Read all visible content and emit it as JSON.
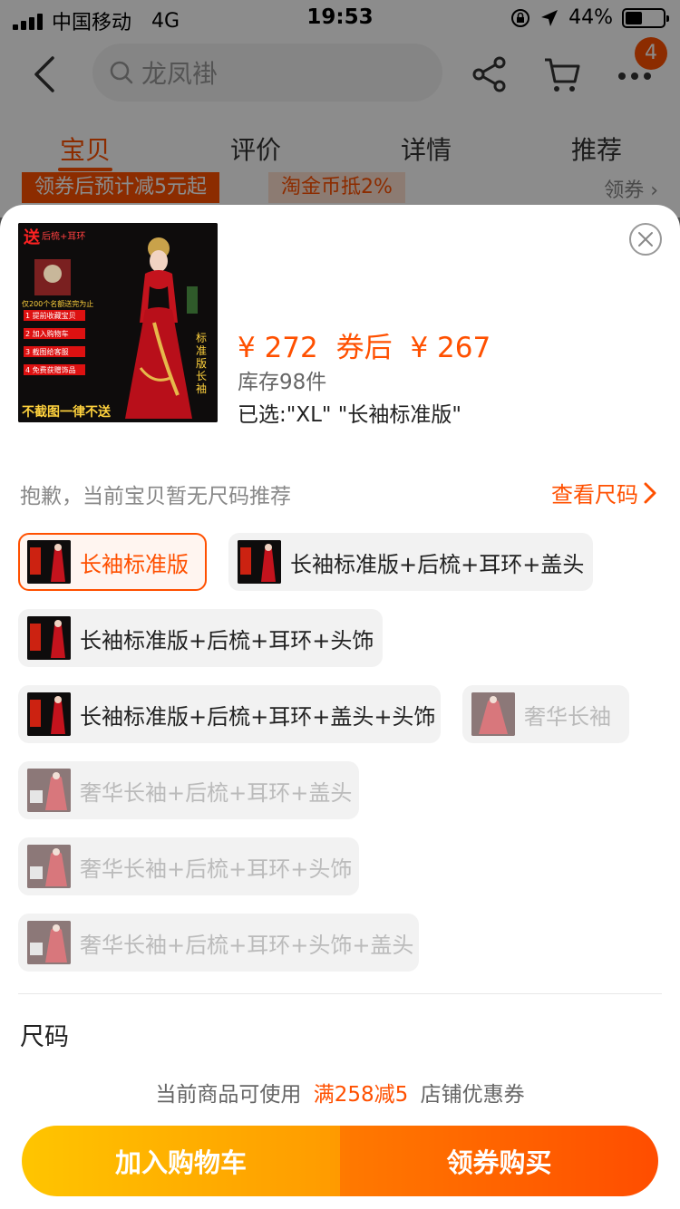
{
  "status_bar": {
    "carrier": "中国移动",
    "network": "4G",
    "time": "19:53",
    "battery": "44%"
  },
  "nav": {
    "search_text": "龙凤褂",
    "cart_badge": "4"
  },
  "tabs": [
    {
      "label": "宝贝"
    },
    {
      "label": "评价"
    },
    {
      "label": "详情"
    },
    {
      "label": "推荐"
    }
  ],
  "promo": {
    "chip1": "领券后预计减5元起",
    "chip2": "淘金币抵2%",
    "get": "领券"
  },
  "product": {
    "price": "¥ 272",
    "after_coupon_label": "券后",
    "after_coupon_price": "¥ 267",
    "stock": "库存98件",
    "selected": "已选:\"XL\" \"长袖标准版\"",
    "thumb_send": "送",
    "thumb_gifts": "后梳+耳环",
    "thumb_limit": "仅200个名额送完为止",
    "thumb_steps": [
      "1 提前收藏宝贝",
      "2 加入购物车",
      "3 截图给客服",
      "4 免费获赠饰品"
    ],
    "thumb_side": "标准版长袖",
    "thumb_footer": "不截图一律不送"
  },
  "size_recommend": {
    "tip": "抱歉，当前宝贝暂无尺码推荐",
    "link": "查看尺码"
  },
  "options": [
    {
      "label": "长袖标准版",
      "state": "selected"
    },
    {
      "label": "长袖标准版+后梳+耳环+盖头",
      "state": "normal"
    },
    {
      "label": "长袖标准版+后梳+耳环+头饰",
      "state": "normal"
    },
    {
      "label": "长袖标准版+后梳+耳环+盖头+头饰",
      "state": "normal"
    },
    {
      "label": "奢华长袖",
      "state": "disabled"
    },
    {
      "label": "奢华长袖+后梳+耳环+盖头",
      "state": "disabled"
    },
    {
      "label": "奢华长袖+后梳+耳环+头饰",
      "state": "disabled"
    },
    {
      "label": "奢华长袖+后梳+耳环+头饰+盖头",
      "state": "disabled"
    }
  ],
  "size_section": {
    "title": "尺码"
  },
  "coupon": {
    "prefix": "当前商品可使用",
    "highlight": "满258减5",
    "suffix": "店铺优惠券"
  },
  "actions": {
    "add_cart": "加入购物车",
    "buy": "领券购买"
  },
  "colors": {
    "accent": "#ff5000",
    "cart_gradient": [
      "#ffc500",
      "#ff9a00"
    ],
    "buy_gradient": [
      "#ff7a00",
      "#ff4d00"
    ]
  }
}
